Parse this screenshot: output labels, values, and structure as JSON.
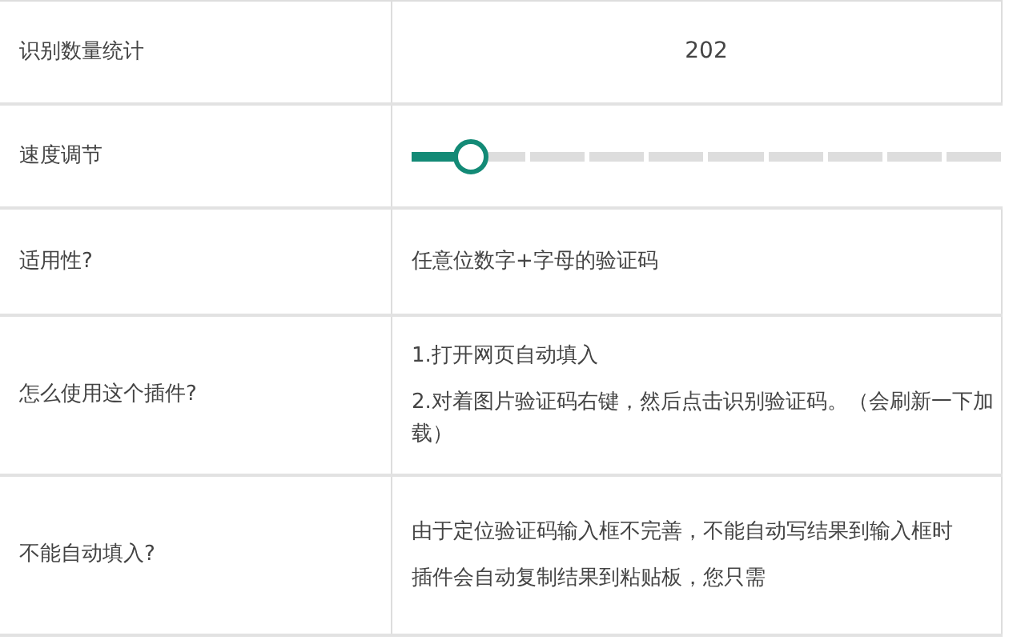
{
  "rows": [
    {
      "label": "识别数量统计",
      "kind": "count",
      "value": "202"
    },
    {
      "label": "速度调节",
      "kind": "slider",
      "level": 0.1
    },
    {
      "label": "适用性?",
      "kind": "text",
      "lines": [
        "任意位数字+字母的验证码"
      ]
    },
    {
      "label": "怎么使用这个插件?",
      "kind": "text",
      "lines": [
        "1.打开网页自动填入",
        "2.对着图片验证码右键，然后点击识别验证码。（会刷新一下加载）"
      ]
    },
    {
      "label": "不能自动填入?",
      "kind": "text",
      "lines": [
        "由于定位验证码输入框不完善，不能自动写结果到输入框时",
        "插件会自动复制结果到粘贴板，您只需"
      ]
    }
  ]
}
